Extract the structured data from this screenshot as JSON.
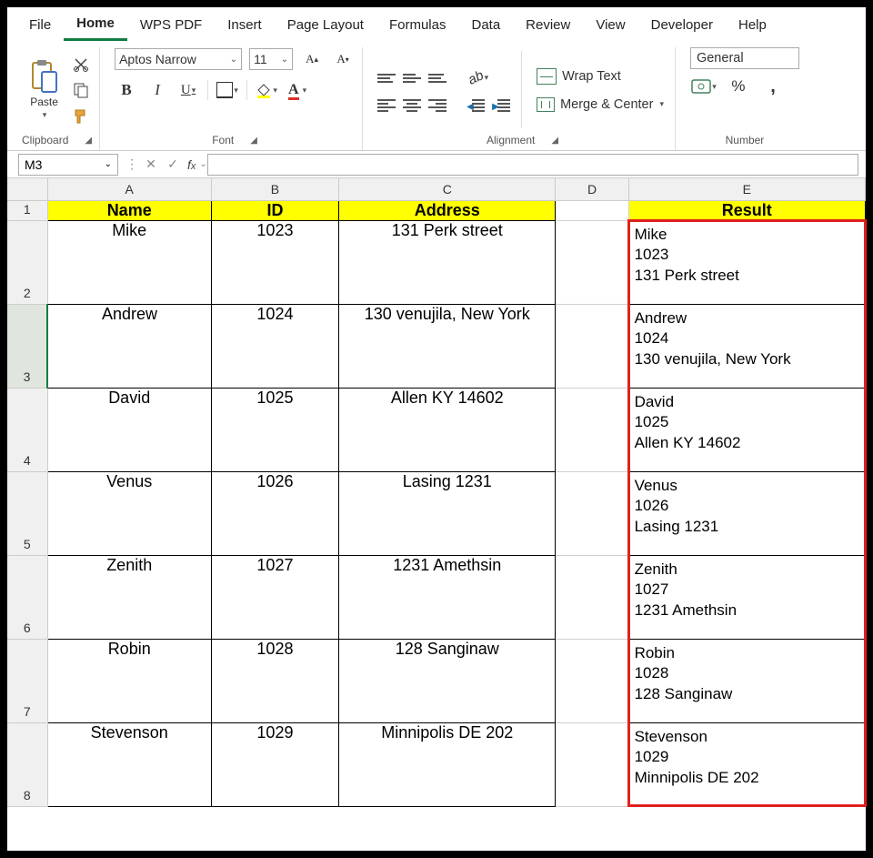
{
  "menu": [
    "File",
    "Home",
    "WPS PDF",
    "Insert",
    "Page Layout",
    "Formulas",
    "Data",
    "Review",
    "View",
    "Developer",
    "Help"
  ],
  "menu_active_index": 1,
  "ribbon": {
    "clipboard": {
      "paste": "Paste",
      "label": "Clipboard"
    },
    "font": {
      "name": "Aptos Narrow",
      "size": "11",
      "label": "Font"
    },
    "alignment": {
      "wrap": "Wrap Text",
      "merge": "Merge & Center",
      "label": "Alignment"
    },
    "number": {
      "format": "General",
      "label": "Number"
    }
  },
  "namebox": "M3",
  "formula": "",
  "columns": [
    "A",
    "B",
    "C",
    "D",
    "E"
  ],
  "headers": {
    "A": "Name",
    "B": "ID",
    "C": "Address",
    "E": "Result"
  },
  "rows": [
    {
      "n": "2",
      "name": "Mike",
      "id": "1023",
      "addr": "131 Perk street",
      "res": [
        "Mike",
        "1023",
        "131 Perk street"
      ]
    },
    {
      "n": "3",
      "name": "Andrew",
      "id": "1024",
      "addr": "130 venujila, New York",
      "res": [
        "Andrew",
        "1024",
        "130 venujila, New York"
      ]
    },
    {
      "n": "4",
      "name": "David",
      "id": "1025",
      "addr": "Allen KY 14602",
      "res": [
        "David",
        "1025",
        "Allen KY 14602"
      ]
    },
    {
      "n": "5",
      "name": "Venus",
      "id": "1026",
      "addr": "Lasing 1231",
      "res": [
        "Venus",
        "1026",
        "Lasing 1231"
      ]
    },
    {
      "n": "6",
      "name": "Zenith",
      "id": "1027",
      "addr": "1231 Amethsin",
      "res": [
        "Zenith",
        "1027",
        "1231 Amethsin"
      ]
    },
    {
      "n": "7",
      "name": "Robin",
      "id": "1028",
      "addr": "128 Sanginaw",
      "res": [
        "Robin",
        "1028",
        "128 Sanginaw"
      ]
    },
    {
      "n": "8",
      "name": "Stevenson",
      "id": "1029",
      "addr": "Minnipolis DE 202",
      "res": [
        "Stevenson",
        "1029",
        "Minnipolis DE 202"
      ]
    }
  ],
  "selected_row_index": 1,
  "chart_data": {
    "type": "table",
    "columns": [
      "Name",
      "ID",
      "Address",
      "Result"
    ],
    "rows": [
      [
        "Mike",
        "1023",
        "131 Perk street",
        "Mike\n1023\n131 Perk street"
      ],
      [
        "Andrew",
        "1024",
        "130 venujila, New York",
        "Andrew\n1024\n130 venujila, New York"
      ],
      [
        "David",
        "1025",
        "Allen KY 14602",
        "David\n1025\nAllen KY 14602"
      ],
      [
        "Venus",
        "1026",
        "Lasing 1231",
        "Venus\n1026\nLasing 1231"
      ],
      [
        "Zenith",
        "1027",
        "1231 Amethsin",
        "Zenith\n1027\n1231 Amethsin"
      ],
      [
        "Robin",
        "1028",
        "128 Sanginaw",
        "Robin\n1028\n128 Sanginaw"
      ],
      [
        "Stevenson",
        "1029",
        "Minnipolis DE 202",
        "Stevenson\n1029\nMinnipolis DE 202"
      ]
    ]
  }
}
